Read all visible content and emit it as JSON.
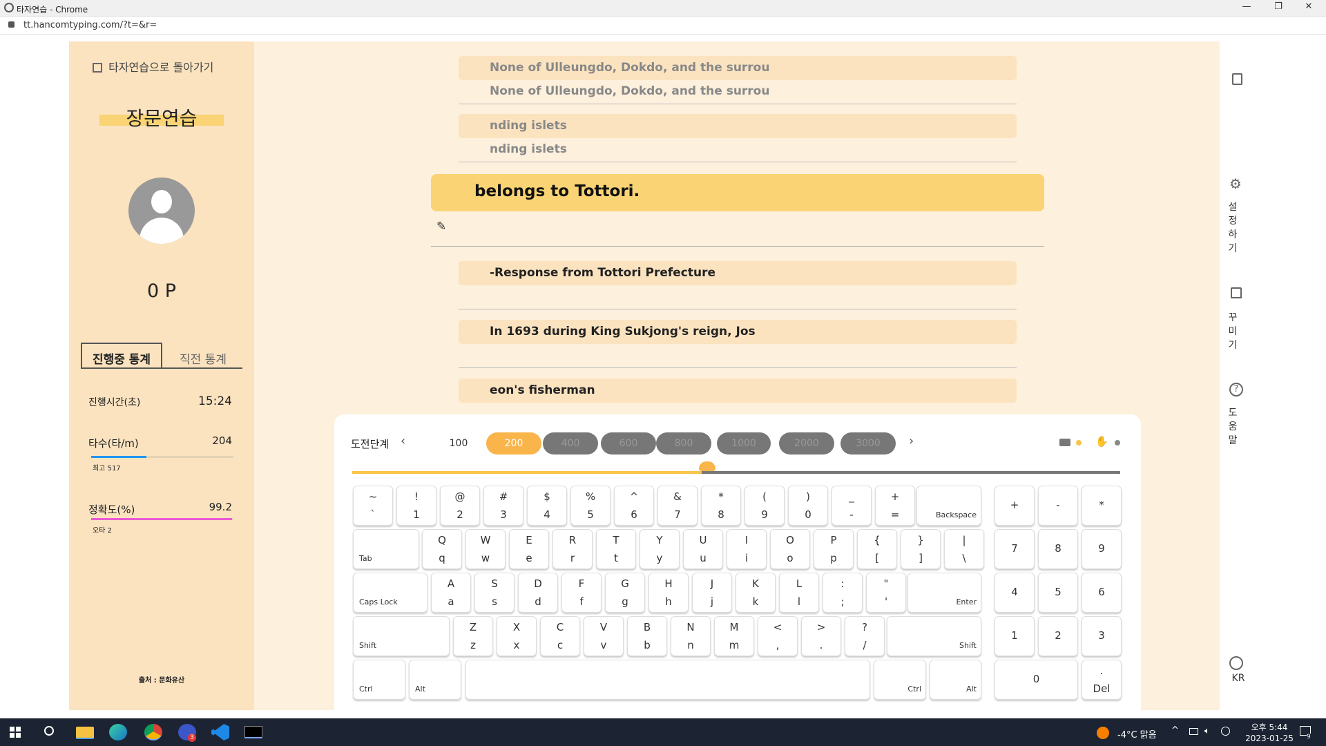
{
  "window": {
    "title": "타자연습 - Chrome",
    "url": "tt.hancomtyping.com/?t=&r="
  },
  "sidebar": {
    "back_label": "타자연습으로 돌아가기",
    "mode_title": "장문연습",
    "points": "0 P",
    "tabs": [
      "진행중 통계",
      "직전 통계"
    ],
    "stats": {
      "time_label": "진행시간(초)",
      "time_value": "15:24",
      "speed_label": "타수(타/m)",
      "speed_value": "204",
      "speed_best": "최고 517",
      "speed_fraction": 0.39,
      "acc_label": "정확도(%)",
      "acc_value": "99.2",
      "acc_errors": "오타 2",
      "acc_fraction": 0.992
    },
    "source": "출처 : 문화유산"
  },
  "lines": {
    "prev1_target": "None of Ulleungdo, Dokdo, and the surrou",
    "prev1_typed": "None of Ulleungdo, Dokdo, and the surrou",
    "prev2_target": "nding islets",
    "prev2_typed": "nding islets",
    "current": "belongs to Tottori.",
    "next1": "-Response from Tottori Prefecture",
    "next2": "In 1693 during King Sukjong's reign, Jos",
    "next3": "eon's fisherman"
  },
  "challenge": {
    "label": "도전단계",
    "levels": [
      "100",
      "200",
      "400",
      "600",
      "800",
      "1000",
      "2000",
      "3000"
    ],
    "active": "200",
    "progress_fraction": 0.455
  },
  "right_nav": {
    "settings": "설정하기",
    "decorate": "꾸미기",
    "help": "도움말",
    "lang": "KR"
  },
  "keys": {
    "row1": [
      [
        "~",
        "`"
      ],
      [
        "!",
        "1"
      ],
      [
        "@",
        "2"
      ],
      [
        "#",
        "3"
      ],
      [
        "$",
        "4"
      ],
      [
        "%",
        "5"
      ],
      [
        "^",
        "6"
      ],
      [
        "&",
        "7"
      ],
      [
        "*",
        "8"
      ],
      [
        "(",
        "9"
      ],
      [
        ")",
        "0"
      ],
      [
        "_",
        "-"
      ],
      [
        "+",
        "="
      ]
    ],
    "row2": [
      [
        "Q",
        "q"
      ],
      [
        "W",
        "w"
      ],
      [
        "E",
        "e"
      ],
      [
        "R",
        "r"
      ],
      [
        "T",
        "t"
      ],
      [
        "Y",
        "y"
      ],
      [
        "U",
        "u"
      ],
      [
        "I",
        "i"
      ],
      [
        "O",
        "o"
      ],
      [
        "P",
        "p"
      ],
      [
        "{",
        "["
      ],
      [
        "}",
        "]"
      ],
      [
        "|",
        "\\"
      ]
    ],
    "row3": [
      [
        "A",
        "a"
      ],
      [
        "S",
        "s"
      ],
      [
        "D",
        "d"
      ],
      [
        "F",
        "f"
      ],
      [
        "G",
        "g"
      ],
      [
        "H",
        "h"
      ],
      [
        "J",
        "j"
      ],
      [
        "K",
        "k"
      ],
      [
        "L",
        "l"
      ],
      [
        ":",
        ";"
      ],
      [
        "\"",
        "'"
      ]
    ],
    "row4": [
      [
        "Z",
        "z"
      ],
      [
        "X",
        "x"
      ],
      [
        "C",
        "c"
      ],
      [
        "V",
        "v"
      ],
      [
        "B",
        "b"
      ],
      [
        "N",
        "n"
      ],
      [
        "M",
        "m"
      ],
      [
        "<",
        ","
      ],
      [
        ">",
        "."
      ],
      [
        "?",
        "/"
      ]
    ],
    "backspace": "Backspace",
    "tab": "Tab",
    "caps": "Caps Lock",
    "enter": "Enter",
    "shift": "Shift",
    "ctrl": "Ctrl",
    "alt": "Alt",
    "numpad_top": [
      "+",
      "-",
      "*"
    ],
    "numpad_rows": [
      [
        "7",
        "8",
        "9"
      ],
      [
        "4",
        "5",
        "6"
      ],
      [
        "1",
        "2",
        "3"
      ]
    ],
    "num0": "0",
    "del_top": ".",
    "del": "Del"
  },
  "taskbar": {
    "weather": "-4°C 맑음",
    "time": "오후 5:44",
    "date": "2023-01-25",
    "notif": "9",
    "badge": "3"
  },
  "colors": {
    "accent": "#fad474",
    "orange": "#f9b44a",
    "blue": "#2196f3",
    "pink": "#e85ad5"
  }
}
